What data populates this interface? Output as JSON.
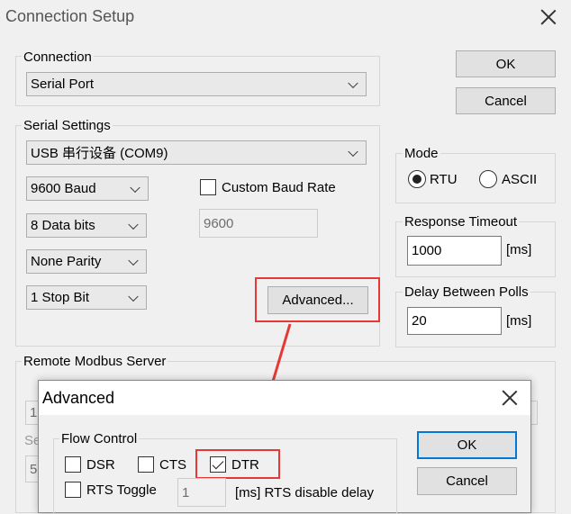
{
  "window": {
    "title": "Connection Setup",
    "ok_label": "OK",
    "cancel_label": "Cancel"
  },
  "connection": {
    "label": "Connection",
    "selected": "Serial Port"
  },
  "serial_settings": {
    "label": "Serial Settings",
    "port": "USB 串行设备 (COM9)",
    "baud": "9600 Baud",
    "data_bits": "8 Data bits",
    "parity": "None Parity",
    "stop_bits": "1 Stop Bit",
    "custom_baud_label": "Custom Baud Rate",
    "custom_baud_value": "9600",
    "advanced_label": "Advanced..."
  },
  "mode": {
    "label": "Mode",
    "rtu_label": "RTU",
    "ascii_label": "ASCII",
    "selected": "RTU"
  },
  "response_timeout": {
    "label": "Response Timeout",
    "value": "1000",
    "unit": "[ms]"
  },
  "delay_between_polls": {
    "label": "Delay Between Polls",
    "value": "20",
    "unit": "[ms]"
  },
  "remote_server": {
    "label": "Remote Modbus Server",
    "partial_1": "1",
    "partial_2": "Se",
    "partial_3": "5"
  },
  "advanced_dialog": {
    "title": "Advanced",
    "flow_control_label": "Flow Control",
    "dsr_label": "DSR",
    "cts_label": "CTS",
    "dtr_label": "DTR",
    "rts_toggle_label": "RTS Toggle",
    "rts_delay_value": "1",
    "rts_delay_label": "[ms] RTS disable delay",
    "ok_label": "OK",
    "cancel_label": "Cancel",
    "dtr_checked": true
  },
  "colors": {
    "highlight": "#e53935",
    "focus_blue": "#0078d7"
  }
}
